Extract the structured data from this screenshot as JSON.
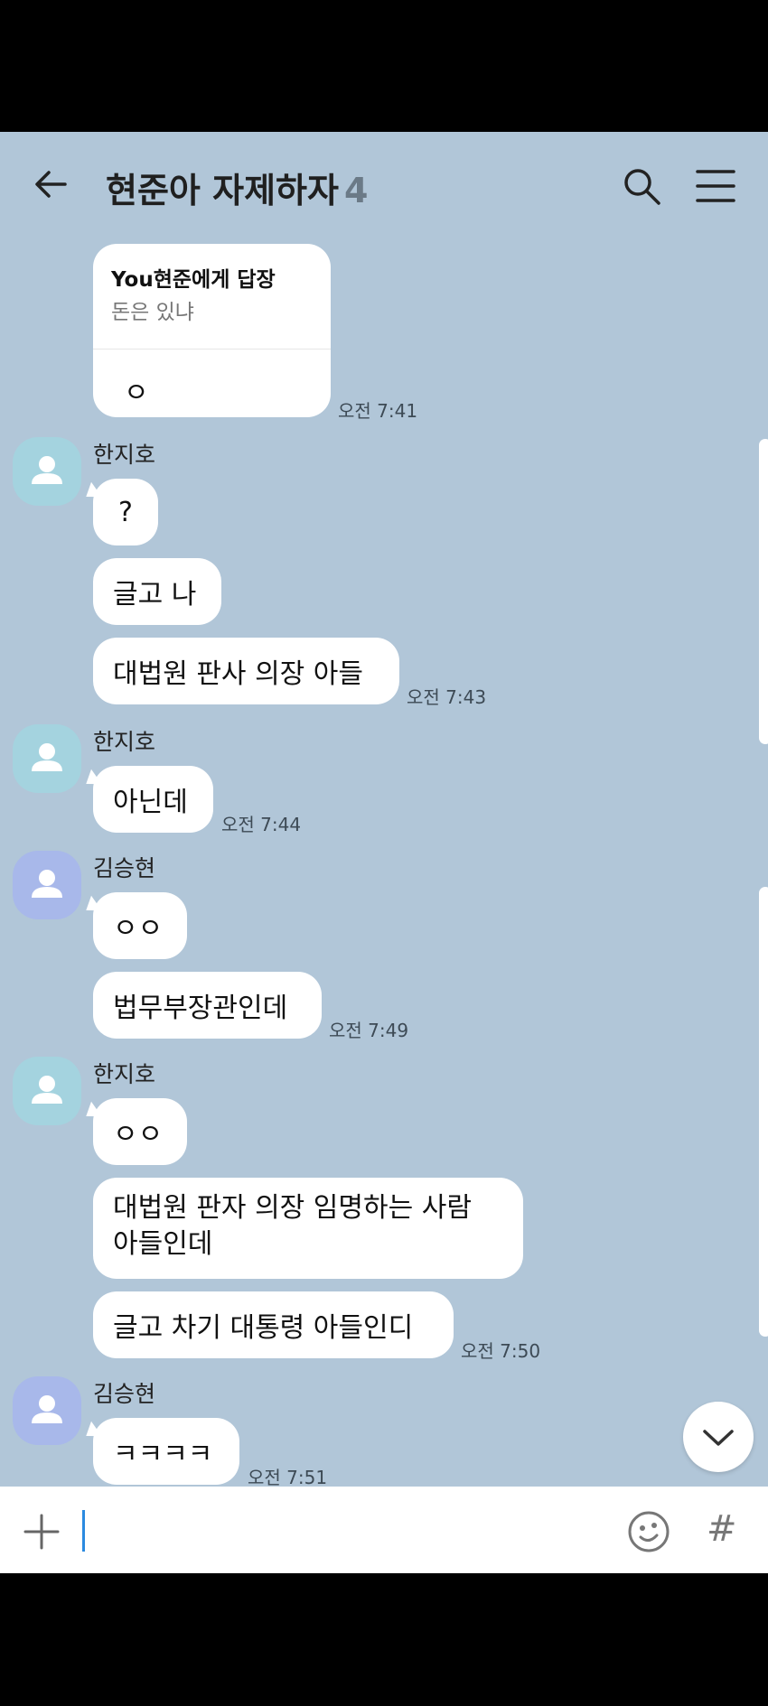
{
  "header": {
    "title": "현준아 자제하자",
    "member_count": "4"
  },
  "reply_message": {
    "reply_to": "You현준에게 답장",
    "quoted_text": "돈은 있냐",
    "text": "ㅇ",
    "time": "오전 7:41"
  },
  "groups": [
    {
      "sender": "한지호",
      "avatar_color": "#a4d3df",
      "messages": [
        "?",
        "글고 나",
        "대법원 판사 의장 아들"
      ],
      "time": "오전 7:43"
    },
    {
      "sender": "한지호",
      "avatar_color": "#a4d3df",
      "messages": [
        "아닌데"
      ],
      "time": "오전 7:44"
    },
    {
      "sender": "김승현",
      "avatar_color": "#a8b8ea",
      "messages": [
        "ㅇㅇ",
        "법무부장관인데"
      ],
      "time": "오전 7:49"
    },
    {
      "sender": "한지호",
      "avatar_color": "#a4d3df",
      "messages": [
        "ㅇㅇ",
        "대법원 판자 의장 임명하는 사람 아들인데",
        "글고 차기 대통령 아들인디"
      ],
      "time": "오전 7:50"
    },
    {
      "sender": "김승현",
      "avatar_color": "#a8b8ea",
      "messages": [
        "ㅋㅋㅋㅋ"
      ],
      "time": "오전 7:51"
    }
  ],
  "input": {
    "placeholder": "",
    "hash_label": "#"
  },
  "icons": {
    "back": "back-arrow-icon",
    "search": "search-icon",
    "menu": "hamburger-menu-icon",
    "scroll_down": "chevron-down-icon",
    "attach": "plus-icon",
    "emoji": "emoji-icon"
  },
  "colors": {
    "chat_background": "#b1c6d8",
    "bubble": "#ffffff",
    "cursor": "#2b8ae0"
  }
}
